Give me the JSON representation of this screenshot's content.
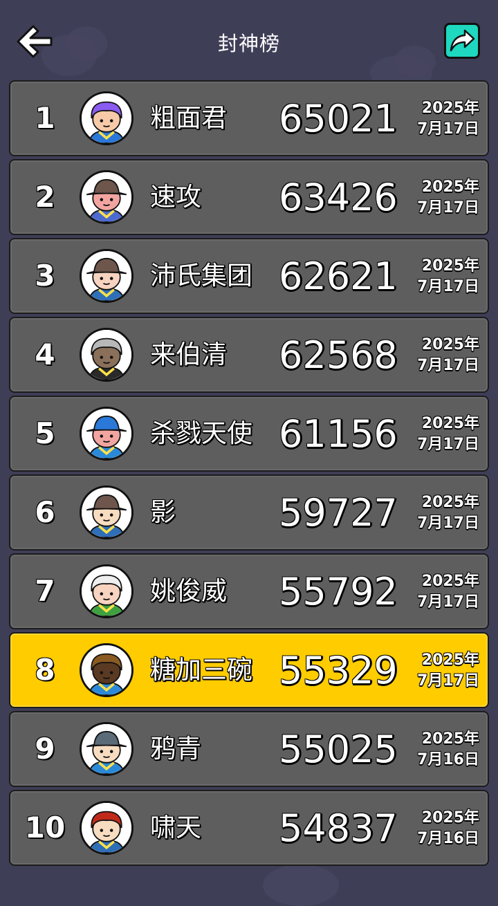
{
  "header": {
    "title": "封神榜",
    "back_icon": "back-arrow-icon",
    "share_icon": "share-arrow-icon"
  },
  "colors": {
    "background": "#3f3e57",
    "row": "#5e5e5e",
    "highlight_row": "#ffcc00",
    "share_button": "#1ed8c0"
  },
  "leaderboard": [
    {
      "rank": "1",
      "name": "粗面君",
      "score": "65021",
      "date_year": "2025年",
      "date_day": "7月17日",
      "avatar": "purple-hair-avatar",
      "highlight": false
    },
    {
      "rank": "2",
      "name": "速攻",
      "score": "63426",
      "date_year": "2025年",
      "date_day": "7月17日",
      "avatar": "brown-hat-avatar",
      "highlight": false
    },
    {
      "rank": "3",
      "name": "沛氏集团",
      "score": "62621",
      "date_year": "2025年",
      "date_day": "7月17日",
      "avatar": "brown-hat-blush-avatar",
      "highlight": false
    },
    {
      "rank": "4",
      "name": "来伯清",
      "score": "62568",
      "date_year": "2025年",
      "date_day": "7月17日",
      "avatar": "grey-hair-avatar",
      "highlight": false
    },
    {
      "rank": "5",
      "name": "杀戮天使",
      "score": "61156",
      "date_year": "2025年",
      "date_day": "7月17日",
      "avatar": "blue-helmet-avatar",
      "highlight": false
    },
    {
      "rank": "6",
      "name": "影",
      "score": "59727",
      "date_year": "2025年",
      "date_day": "7月17日",
      "avatar": "brown-hat-blonde-avatar",
      "highlight": false
    },
    {
      "rank": "7",
      "name": "姚俊威",
      "score": "55792",
      "date_year": "2025年",
      "date_day": "7月17日",
      "avatar": "white-hair-glasses-avatar",
      "highlight": false
    },
    {
      "rank": "8",
      "name": "糖加三碗",
      "score": "55329",
      "date_year": "2025年",
      "date_day": "7月17日",
      "avatar": "brown-hair-dark-skin-avatar",
      "highlight": true
    },
    {
      "rank": "9",
      "name": "鸦青",
      "score": "55025",
      "date_year": "2025年",
      "date_day": "7月16日",
      "avatar": "grey-hat-avatar",
      "highlight": false
    },
    {
      "rank": "10",
      "name": "啸天",
      "score": "54837",
      "date_year": "2025年",
      "date_day": "7月16日",
      "avatar": "red-hair-avatar",
      "highlight": false
    }
  ]
}
